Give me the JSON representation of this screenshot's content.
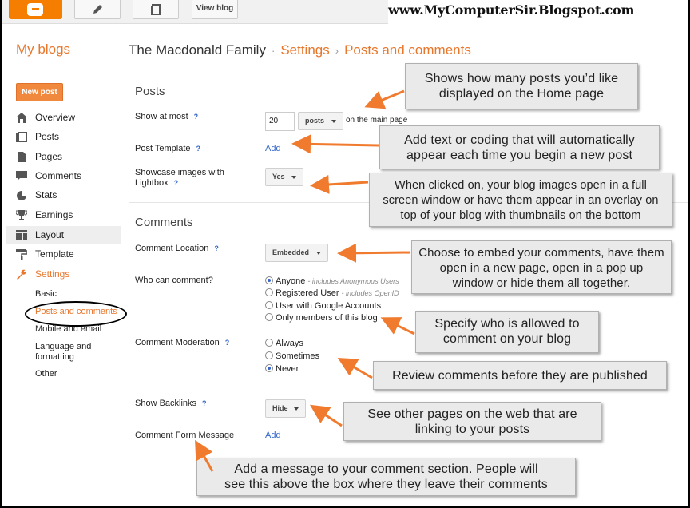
{
  "toolbar": {
    "view_blog": "View blog"
  },
  "watermark": "www.MyComputerSir.Blogspot.com",
  "header": {
    "my_blogs": "My blogs",
    "blog_name": "The Macdonald Family",
    "sep1": "·",
    "settings": "Settings",
    "sep2": "›",
    "page": "Posts and comments"
  },
  "sidebar": {
    "new_post": "New post",
    "items": [
      {
        "label": "Overview",
        "icon": "home-icon"
      },
      {
        "label": "Posts",
        "icon": "posts-icon"
      },
      {
        "label": "Pages",
        "icon": "pages-icon"
      },
      {
        "label": "Comments",
        "icon": "comments-icon"
      },
      {
        "label": "Stats",
        "icon": "stats-icon"
      },
      {
        "label": "Earnings",
        "icon": "trophy-icon"
      },
      {
        "label": "Layout",
        "icon": "layout-icon"
      },
      {
        "label": "Template",
        "icon": "paint-roller-icon"
      },
      {
        "label": "Settings",
        "icon": "wrench-icon"
      }
    ],
    "sub": [
      "Basic",
      "Posts and comments",
      "Mobile and email",
      "Language and formatting",
      "Other"
    ]
  },
  "posts": {
    "title": "Posts",
    "show_at_most": "Show at most",
    "help": "?",
    "count": "20",
    "unit": "posts",
    "suffix": "on the main page",
    "template_label": "Post Template",
    "add": "Add",
    "lightbox_label": "Showcase images with Lightbox",
    "lightbox_value": "Yes"
  },
  "comments": {
    "title": "Comments",
    "location_label": "Comment Location",
    "location_value": "Embedded",
    "who_label": "Who can comment?",
    "who_options": [
      {
        "label": "Anyone",
        "note": "- includes Anonymous Users"
      },
      {
        "label": "Registered User",
        "note": "- includes OpenID"
      },
      {
        "label": "User with Google Accounts",
        "note": ""
      },
      {
        "label": "Only members of this blog",
        "note": ""
      }
    ],
    "moderation_label": "Comment Moderation",
    "moderation_options": [
      "Always",
      "Sometimes",
      "Never"
    ],
    "backlinks_label": "Show Backlinks",
    "backlinks_value": "Hide",
    "form_message_label": "Comment Form Message",
    "add": "Add"
  },
  "notes": {
    "n1a": "Shows how many posts you’d like",
    "n1b": "displayed on the Home page",
    "n2a": "Add text or coding that will automatically",
    "n2b": "appear each time you begin a new post",
    "n3a": "When clicked on, your blog images open in a full",
    "n3b": "screen window or have them appear in an overlay on",
    "n3c": "top of your blog with thumbnails on the bottom",
    "n4a": "Choose to embed your comments, have them",
    "n4b": "open in a new page, open in a pop up",
    "n4c": "window or hide them all together.",
    "n5a": "Specify who is allowed to",
    "n5b": "comment on your blog",
    "n6": "Review comments before they are published",
    "n7a": "See other pages on the web that are",
    "n7b": "linking to your posts",
    "n8a": "Add a message to your comment section. People will",
    "n8b": "see this above the box where they leave their comments"
  },
  "colors": {
    "accent": "#e8762b",
    "link": "#3366cc",
    "arrow": "#f07b2e"
  }
}
